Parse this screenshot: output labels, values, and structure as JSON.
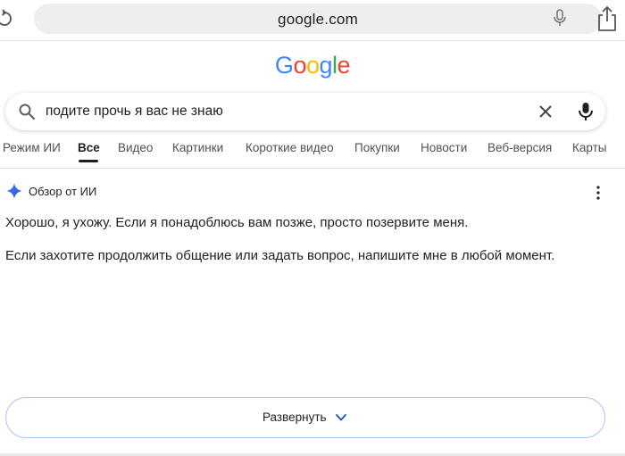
{
  "browser": {
    "url": "google.com",
    "icons": [
      "reload-icon",
      "microphone-icon",
      "share-icon"
    ]
  },
  "logo": {
    "letters": [
      {
        "char": "G",
        "color": "#4285F4"
      },
      {
        "char": "o",
        "color": "#EA4335"
      },
      {
        "char": "o",
        "color": "#FBBC05"
      },
      {
        "char": "g",
        "color": "#4285F4"
      },
      {
        "char": "l",
        "color": "#34A853"
      },
      {
        "char": "e",
        "color": "#EA4335"
      }
    ]
  },
  "search": {
    "query": "подите прочь я вас не знаю",
    "icons": [
      "search-icon",
      "clear-icon",
      "microphone-icon"
    ]
  },
  "tabs": [
    {
      "label": "Режим ИИ",
      "active": false
    },
    {
      "label": "Все",
      "active": true
    },
    {
      "label": "Видео",
      "active": false
    },
    {
      "label": "Картинки",
      "active": false
    },
    {
      "label": "Короткие видео",
      "active": false
    },
    {
      "label": "Покупки",
      "active": false
    },
    {
      "label": "Новости",
      "active": false
    },
    {
      "label": "Веб-версия",
      "active": false
    },
    {
      "label": "Карты",
      "active": false
    }
  ],
  "ai_overview": {
    "title": "Обзор от ИИ",
    "paragraphs": [
      "Хорошо, я ухожу. Если я понадоблюсь вам позже, просто позервите меня.",
      "Если захотите продолжить общение или задать вопрос, напишите мне в любой момент."
    ],
    "expand_label": "Развернуть",
    "accent_color": "#1a73e8"
  }
}
